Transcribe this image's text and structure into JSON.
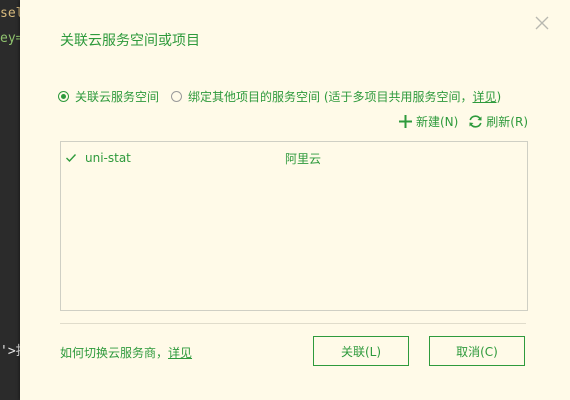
{
  "editor": {
    "lines": [
      {
        "text": "sel",
        "tone": "yellow"
      },
      {
        "text": "ey=",
        "tone": "green"
      },
      {
        "text": "'>扫",
        "tone": "light"
      }
    ]
  },
  "dialog": {
    "title": "关联云服务空间或项目",
    "close_icon": "close-icon",
    "options": [
      {
        "label": "关联云服务空间",
        "selected": true
      },
      {
        "label_prefix": "绑定其他项目的服务空间 (适于多项目共用服务空间，",
        "link": "详见",
        "label_suffix": ")",
        "selected": false
      }
    ],
    "toolbar": {
      "new_label": "新建(N)",
      "refresh_label": "刷新(R)"
    },
    "spaces": [
      {
        "name": "uni-stat",
        "provider": "阿里云",
        "checked": true
      }
    ],
    "help_text": "如何切换云服务商，",
    "help_link": "详见",
    "associate_label": "关联(L)",
    "cancel_label": "取消(C)",
    "colors": {
      "accent": "#2e9a3c",
      "background": "#fffae8"
    }
  }
}
